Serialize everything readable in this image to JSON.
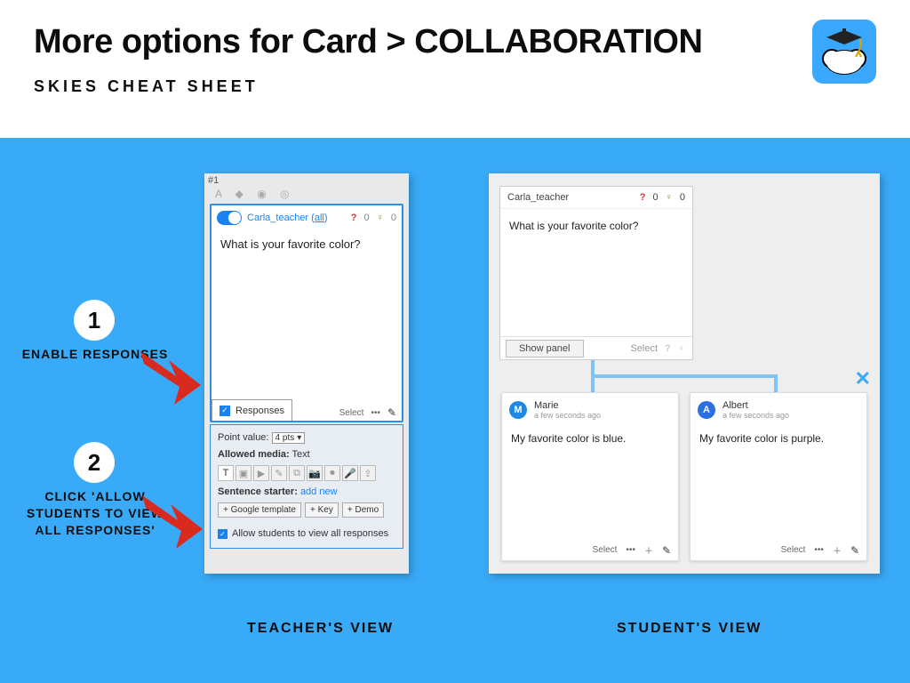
{
  "header": {
    "title": "More options for Card > COLLABORATION",
    "subtitle": "SKIES CHEAT SHEET"
  },
  "steps": {
    "one_num": "1",
    "one_label": "ENABLE RESPONSES",
    "two_num": "2",
    "two_label": "CLICK 'ALLOW STUDENTS TO VIEW ALL RESPONSES'"
  },
  "teacher": {
    "card_number": "#1",
    "author": "Carla_teacher",
    "author_scope": "all",
    "question_count": "0",
    "idea_count": "0",
    "question_text": "What is your favorite color?",
    "responses_tab": "Responses",
    "select": "Select",
    "point_value_label": "Point value:",
    "point_value": "4 pts",
    "allowed_media_label": "Allowed media:",
    "allowed_media_value": "Text",
    "sentence_starter_label": "Sentence starter:",
    "sentence_starter_action": "add new",
    "btn_google": "+ Google template",
    "btn_key": "+ Key",
    "btn_demo": "+ Demo",
    "allow_label": "Allow students to view all responses"
  },
  "student": {
    "author": "Carla_teacher",
    "question_count": "0",
    "idea_count": "0",
    "question_text": "What is your favorite color?",
    "show_panel": "Show panel",
    "select": "Select",
    "responses": [
      {
        "initial": "M",
        "name": "Marie",
        "time": "a few seconds ago",
        "text": "My favorite color is blue."
      },
      {
        "initial": "A",
        "name": "Albert",
        "time": "a few seconds ago",
        "text": "My favorite color is purple."
      }
    ]
  },
  "labels": {
    "teacher_view": "TEACHER'S VIEW",
    "student_view": "STUDENT'S VIEW"
  }
}
